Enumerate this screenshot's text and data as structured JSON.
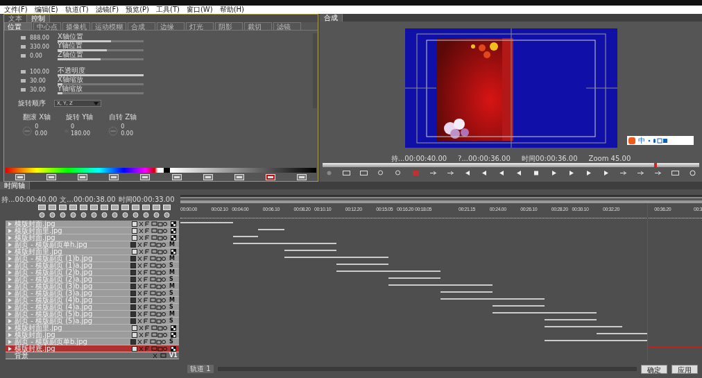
{
  "menu": [
    "文件(F)",
    "编辑(E)",
    "轨道(T)",
    "滤镜(F)",
    "预览(P)",
    "工具(T)",
    "窗口(W)",
    "帮助(H)"
  ],
  "control_panel": {
    "tabs": [
      {
        "label": "文本",
        "selected": false
      },
      {
        "label": "控制",
        "selected": true
      }
    ],
    "subtabs": [
      {
        "label": "位置",
        "selected": true
      },
      {
        "label": "中心点",
        "selected": false
      },
      {
        "label": "摄像机",
        "selected": false
      },
      {
        "label": "运动模糊",
        "selected": false
      },
      {
        "label": "合成",
        "selected": false
      },
      {
        "label": "边缘",
        "selected": false
      },
      {
        "label": "灯光",
        "selected": false
      },
      {
        "label": "阴影",
        "selected": false
      },
      {
        "label": "裁切",
        "selected": false
      },
      {
        "label": "滤镜",
        "selected": false
      }
    ],
    "params": [
      {
        "value": "888.00",
        "label": "X轴位置",
        "level": 0.62
      },
      {
        "value": "330.00",
        "label": "Y轴位置",
        "level": 0.57
      },
      {
        "value": "0.00",
        "label": "Z轴位置",
        "level": 0.5
      },
      {
        "value": "100.00",
        "label": "不透明度",
        "level": 1.0
      },
      {
        "value": "30.00",
        "label": "X轴缩放",
        "level": 0.06
      },
      {
        "value": "30.00",
        "label": "Y轴缩放",
        "level": 0.06
      }
    ],
    "rotation_order": {
      "label": "旋转顺序",
      "value": "X, Y, Z"
    },
    "rotations": [
      {
        "label": "翻滚 X轴",
        "turns": "0",
        "angle": "0.00"
      },
      {
        "label": "旋转 Y轴",
        "turns": "0",
        "angle": "180.00"
      },
      {
        "label": "自转 Z轴",
        "turns": "0",
        "angle": "0.00"
      }
    ]
  },
  "preview": {
    "tab": "合成",
    "ime_toolbar": {
      "label": "中"
    },
    "info": [
      "持...00:00:40.00",
      "?...00:00:36.00",
      "时间00:00:36.00",
      "Zoom  45.00"
    ],
    "scrubber": {
      "level": 0.88
    }
  },
  "timeline": {
    "tab": "时间轴",
    "info": [
      "持...00:00:40.00",
      "文...00:00:38.00",
      "时间00:00:33.00"
    ],
    "ruler": [
      "00:00.00",
      "00:02.10",
      "00:04.00",
      "00:06.10",
      "00:08.20",
      "00:10.10",
      "00:12.20",
      "00:15.05",
      "00:16.20",
      "00:18.05",
      "00:21.15",
      "00:24.00",
      "00:26.10",
      "00:28.20",
      "00:30.10",
      "00:32.20",
      "00:36.20"
    ],
    "ruler_edge": "00:3",
    "playhead": {
      "level": 0.895
    },
    "tracks": [
      {
        "name": "横版封面.jpg",
        "selected": false
      },
      {
        "name": "横版封面里.jpg",
        "selected": false
      },
      {
        "name": "横版封面.jpg",
        "selected": false
      },
      {
        "name": "副页 - 横版副页单h.jpg",
        "selected": false,
        "badge": "M"
      },
      {
        "name": "横版封面里.jpg",
        "selected": false
      },
      {
        "name": "副页 - 横版副页 (1)b.jpg",
        "selected": false,
        "badge": "M"
      },
      {
        "name": "副页 - 横版副页 (1)a.jpg",
        "selected": false,
        "badge": "S"
      },
      {
        "name": "副页 - 横版副页 (2)b.jpg",
        "selected": false,
        "badge": "M"
      },
      {
        "name": "副页 - 横版副页 (2)a.jpg",
        "selected": false,
        "badge": "S"
      },
      {
        "name": "副页 - 横版副页 (3)b.jpg",
        "selected": false,
        "badge": "M"
      },
      {
        "name": "副页 - 横版副页 (3)a.jpg",
        "selected": false,
        "badge": "S"
      },
      {
        "name": "副页 - 横版副页 (4)b.jpg",
        "selected": false,
        "badge": "M"
      },
      {
        "name": "副页 - 横版副页 (4)a.jpg",
        "selected": false,
        "badge": "S"
      },
      {
        "name": "副页 - 横版副页 (5)b.jpg",
        "selected": false,
        "badge": "M"
      },
      {
        "name": "副页 - 横版副页 (5)a.jpg",
        "selected": false,
        "badge": "S"
      },
      {
        "name": "横版封面里.jpg",
        "selected": false
      },
      {
        "name": "横版封面.jpg",
        "selected": false
      },
      {
        "name": "副页 - 横版副页单b.jpg",
        "selected": false,
        "badge": "S"
      },
      {
        "name": "横版封底.jpg",
        "selected": true
      }
    ],
    "background_track": {
      "name": "背景",
      "badge": "V1"
    },
    "scroll_label": "轨道 1"
  },
  "buttons": [
    "确定",
    "应用"
  ]
}
